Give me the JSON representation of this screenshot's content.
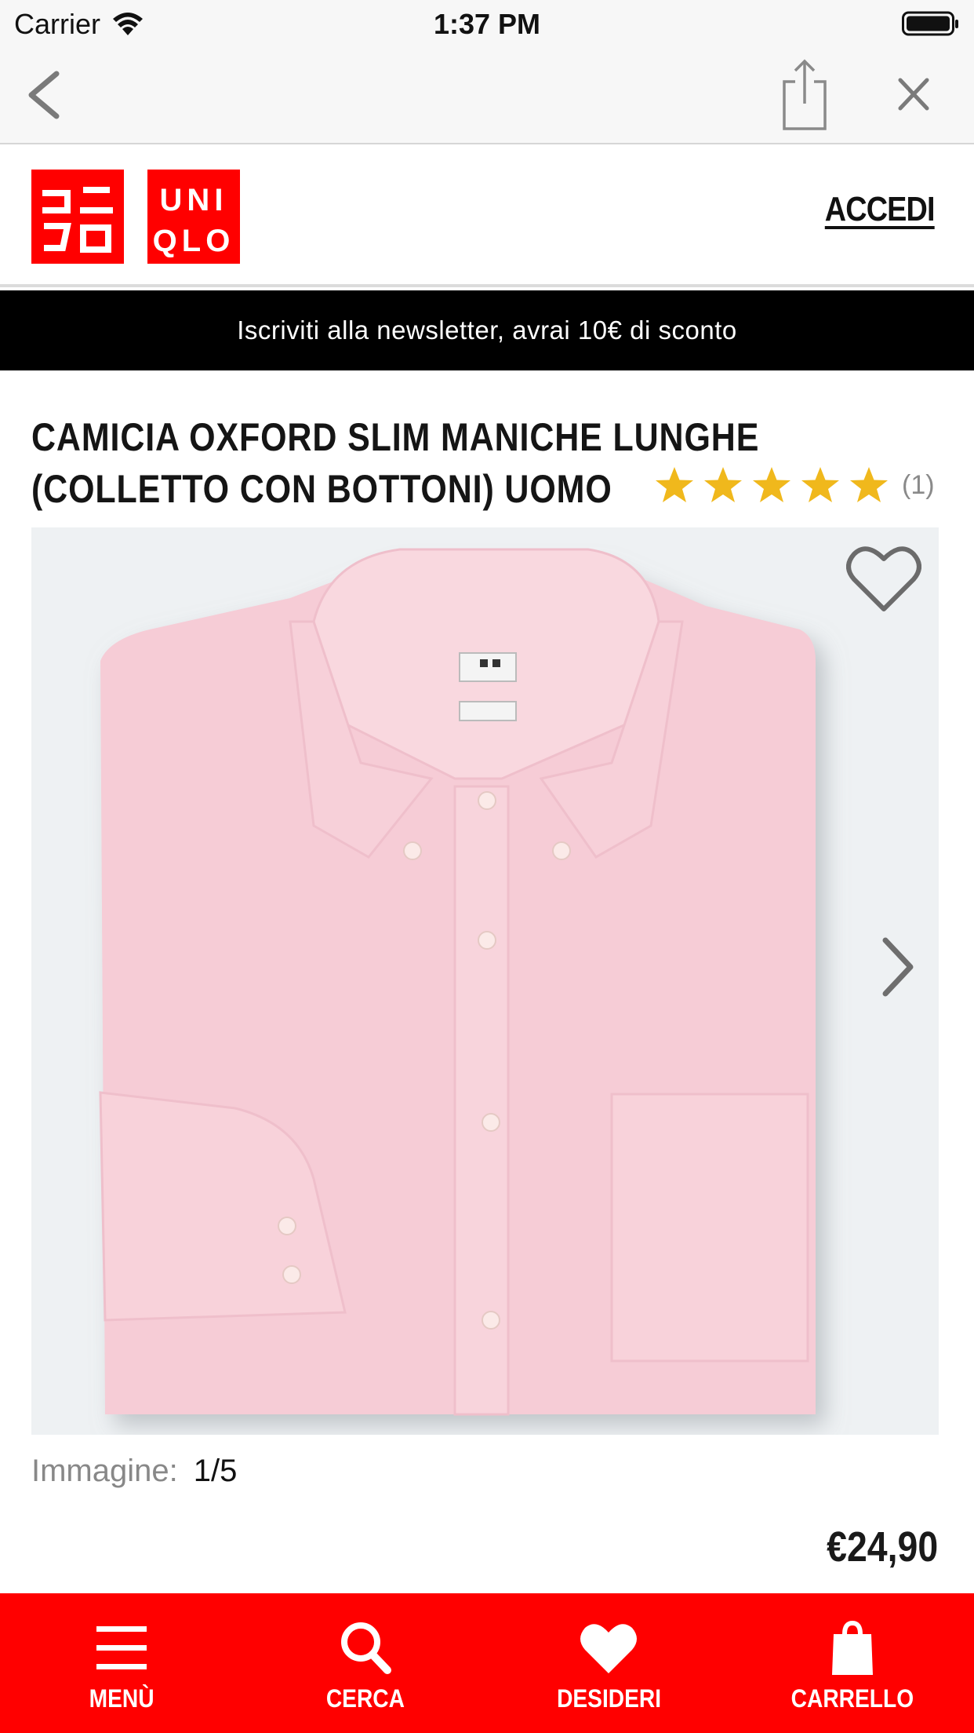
{
  "status_bar": {
    "carrier": "Carrier",
    "time": "1:37 PM"
  },
  "header": {
    "logo_text": [
      "ユニ",
      "クロ",
      "UNI",
      "QLO"
    ],
    "login_label": "ACCEDI"
  },
  "banner": {
    "text": "Iscriviti alla newsletter, avrai 10€ di sconto"
  },
  "product": {
    "title_line1": "CAMICIA OXFORD SLIM MANICHE LUNGHE",
    "title_line2": "(COLLETTO CON BOTTONI) UOMO",
    "rating_stars": 5,
    "rating_count": "(1)",
    "image_label": "Immagine:",
    "image_counter": "1/5",
    "price": "€24,90",
    "shirt_color": "#f7cfd8"
  },
  "tabs": [
    {
      "label": "MENÙ",
      "icon": "menu-icon"
    },
    {
      "label": "CERCA",
      "icon": "search-icon"
    },
    {
      "label": "DESIDERI",
      "icon": "heart-icon"
    },
    {
      "label": "CARRELLO",
      "icon": "bag-icon"
    }
  ],
  "colors": {
    "brand_red": "#ff0000",
    "star": "#f0b81c",
    "banner_bg": "#000000"
  }
}
